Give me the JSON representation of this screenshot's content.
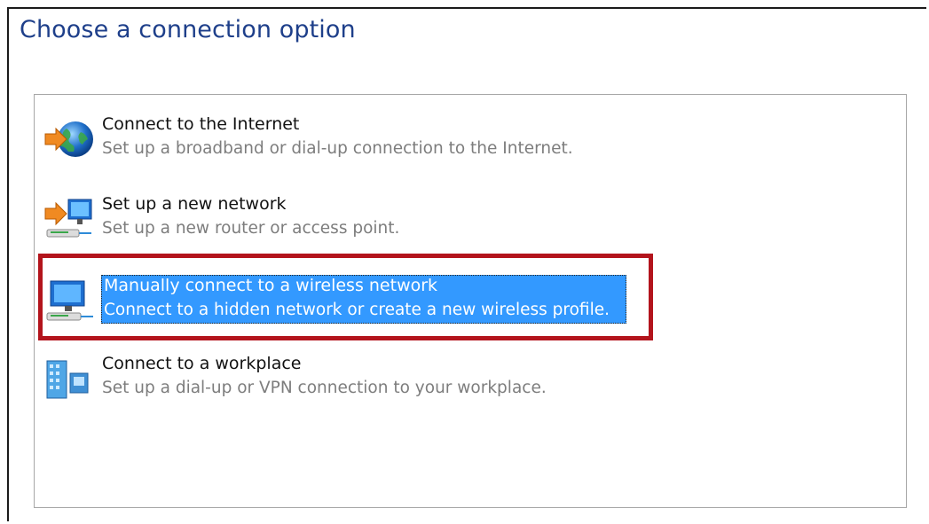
{
  "page": {
    "title": "Choose a connection option"
  },
  "options": [
    {
      "title": "Connect to the Internet",
      "description": "Set up a broadband or dial-up connection to the Internet.",
      "icon": "globe-arrow-icon",
      "selected": false
    },
    {
      "title": "Set up a new network",
      "description": "Set up a new router or access point.",
      "icon": "network-setup-icon",
      "selected": false
    },
    {
      "title": "Manually connect to a wireless network",
      "description": "Connect to a hidden network or create a new wireless profile.",
      "icon": "wireless-network-icon",
      "selected": true
    },
    {
      "title": "Connect to a workplace",
      "description": "Set up a dial-up or VPN connection to your workplace.",
      "icon": "workplace-icon",
      "selected": false
    }
  ],
  "colors": {
    "title": "#1e3f8a",
    "selection": "#3399ff",
    "highlight_border": "#b3141c",
    "description": "#7d7d7d"
  }
}
